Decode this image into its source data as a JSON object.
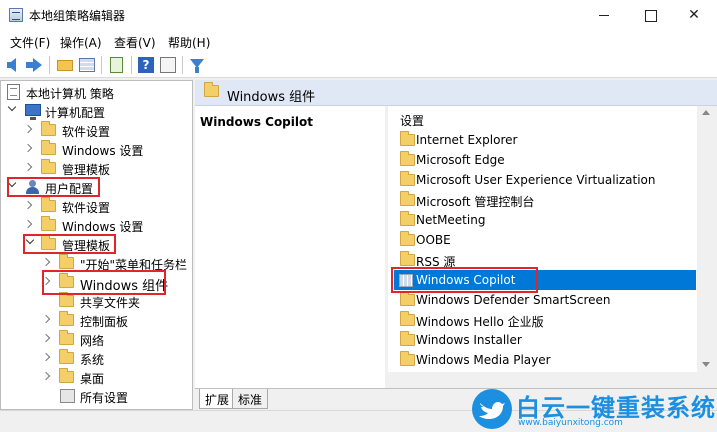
{
  "window": {
    "title": "本地组策略编辑器"
  },
  "menu": {
    "file": "文件(F)",
    "action": "操作(A)",
    "view": "查看(V)",
    "help": "帮助(H)"
  },
  "tree": {
    "root": "本地计算机 策略",
    "computer_config": "计算机配置",
    "cc_software": "软件设置",
    "cc_windows": "Windows 设置",
    "cc_admin": "管理模板",
    "user_config": "用户配置",
    "uc_software": "软件设置",
    "uc_windows": "Windows 设置",
    "uc_admin": "管理模板",
    "start_menu": "\"开始\"菜单和任务栏",
    "windows_components": "Windows 组件",
    "shared_folders": "共享文件夹",
    "control_panel": "控制面板",
    "network": "网络",
    "system": "系统",
    "desktop": "桌面",
    "all_settings": "所有设置"
  },
  "header": {
    "title": "Windows 组件"
  },
  "description": {
    "title": "Windows Copilot"
  },
  "list": {
    "column": "设置",
    "items": [
      "Internet Explorer",
      "Microsoft Edge",
      "Microsoft User Experience Virtualization",
      "Microsoft 管理控制台",
      "NetMeeting",
      "OOBE",
      "RSS 源",
      "Windows Copilot",
      "Windows Defender SmartScreen",
      "Windows Hello 企业版",
      "Windows Installer",
      "Windows Media Player"
    ]
  },
  "tabs": {
    "extended": "扩展",
    "standard": "标准"
  },
  "watermark": {
    "name": "白云一键重装系统",
    "url": "www.baiyunxitong.com"
  },
  "colors": {
    "selection": "#0078d7",
    "highlight_box": "#e0262a",
    "header_bg": "#dfe8f4",
    "watermark": "#1d8fe1"
  }
}
